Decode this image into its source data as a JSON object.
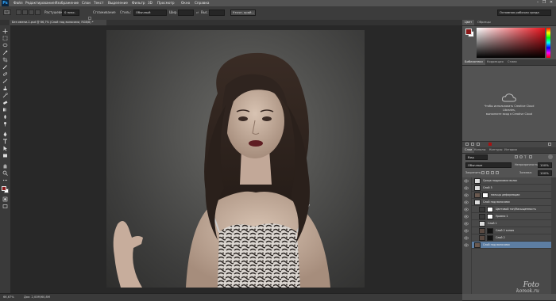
{
  "app": {
    "logo": "Ps"
  },
  "menubar": {
    "items": [
      "Файл",
      "Редактирование",
      "Изображение",
      "Слои",
      "Текст",
      "Выделение",
      "Фильтр",
      "3D",
      "Просмотр",
      "Окно",
      "Справка"
    ]
  },
  "window_controls": {
    "minimize": "–",
    "restore": "❐",
    "close": "✕"
  },
  "options_bar": {
    "feather_label": "Растушевка:",
    "feather_value": "0 пикс.",
    "antialias_label": "Сглаживание",
    "style_label": "Стиль:",
    "style_value": "Обычный",
    "width_label": "Шир.:",
    "height_label": "Выс.:",
    "refine_edge_label": "Уточн. край...",
    "workspace_value": "Основная рабочая среда"
  },
  "document_tab": {
    "title": "Без имени-1.psd @ 66,7% (Слой под волосами, RGB/8) *"
  },
  "statusbar": {
    "zoom": "66,67%",
    "doc_size": "Док: 2,00М/60,8М"
  },
  "color_panel": {
    "tabs": [
      "Цвет",
      "Образцы"
    ],
    "foreground_color": "#8b1a1a",
    "background_color": "#ffffff"
  },
  "libraries_panel": {
    "tabs": [
      "Библиотеки",
      "Коррекция",
      "Стили"
    ],
    "message_lines": [
      "Чтобы использовать Creative Cloud",
      "Libraries,",
      "выполните вход в Creative Cloud"
    ]
  },
  "layers_panel": {
    "tabs": [
      "Слои",
      "Каналы",
      "Контуры",
      "История"
    ],
    "kind_value": "Вид",
    "blend_mode": "Обычные",
    "opacity_label": "Непрозрачность:",
    "opacity_value": "100%",
    "lock_label": "Закрепить:",
    "fill_label": "Заливка:",
    "fill_value": "100%",
    "layers": [
      {
        "name": "Среда подрисовки волос"
      },
      {
        "name": "Слой 5"
      },
      {
        "name": "пальцы деформации"
      },
      {
        "name": "Слой под волосами"
      },
      {
        "name": "Цветовой тон/Насыщенность"
      },
      {
        "name": "Уровни 1"
      },
      {
        "name": "Слой 1"
      },
      {
        "name": "Слой 2 копия"
      },
      {
        "name": "Слой 2"
      },
      {
        "name": "Слой под волосами"
      }
    ]
  },
  "watermark": {
    "line1": "Foto",
    "line2": "komok.ru"
  },
  "colors": {
    "accent": "#8b1a1a",
    "panel_bg": "#535353",
    "app_bg": "#282828"
  }
}
